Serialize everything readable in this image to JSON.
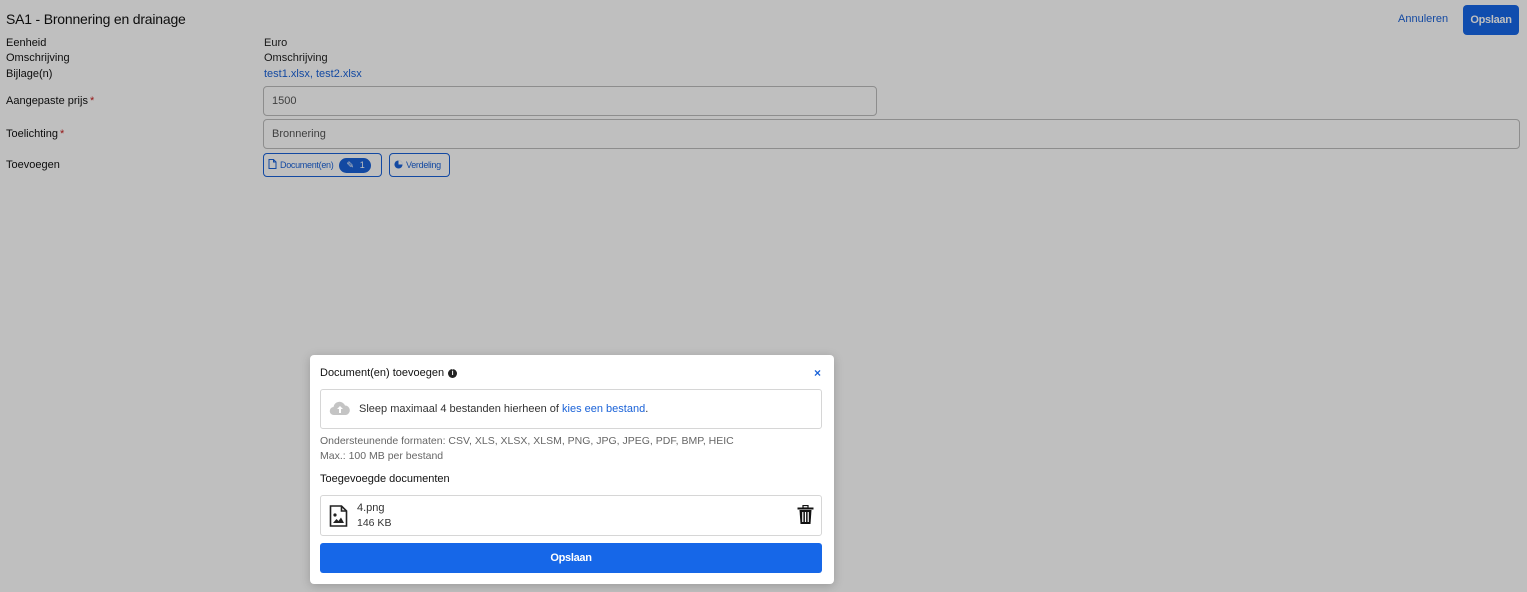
{
  "header": {
    "title": "SA1 - Bronnering en drainage",
    "cancel_label": "Annuleren",
    "save_label": "Opslaan"
  },
  "details": {
    "unit_label": "Eenheid",
    "unit_value": "Euro",
    "description_label": "Omschrijving",
    "description_value": "Omschrijving",
    "attachments_label": "Bijlage(n)",
    "attachments_value": "test1.xlsx, test2.xlsx"
  },
  "form": {
    "price_label": "Aangepaste prijs",
    "price_value": "1500",
    "explanation_label": "Toelichting",
    "explanation_value": "Bronnering",
    "add_label": "Toevoegen",
    "required_marker": "*"
  },
  "add_buttons": {
    "documents_label": "Document(en)",
    "documents_count": "1",
    "distribution_label": "Verdeling"
  },
  "modal": {
    "title": "Document(en) toevoegen",
    "close_glyph": "×",
    "dropzone_text": "Sleep maximaal 4 bestanden hierheen of ",
    "dropzone_link": "kies een bestand",
    "dropzone_end": ".",
    "formats_text": "Ondersteunende formaten:  CSV, XLS, XLSX, XLSM, PNG, JPG, JPEG, PDF, BMP, HEIC",
    "max_text": "Max.: 100 MB per bestand",
    "added_heading": "Toegevoegde documenten",
    "files": [
      {
        "name": "4.png",
        "size": "146 KB",
        "icon": "image-file-icon"
      }
    ],
    "save_label": "Opslaan"
  },
  "colors": {
    "accent": "#1667e8",
    "link": "#1a62d8",
    "required": "#c81e1e",
    "overlay": "rgba(0,0,0,0.25)"
  }
}
